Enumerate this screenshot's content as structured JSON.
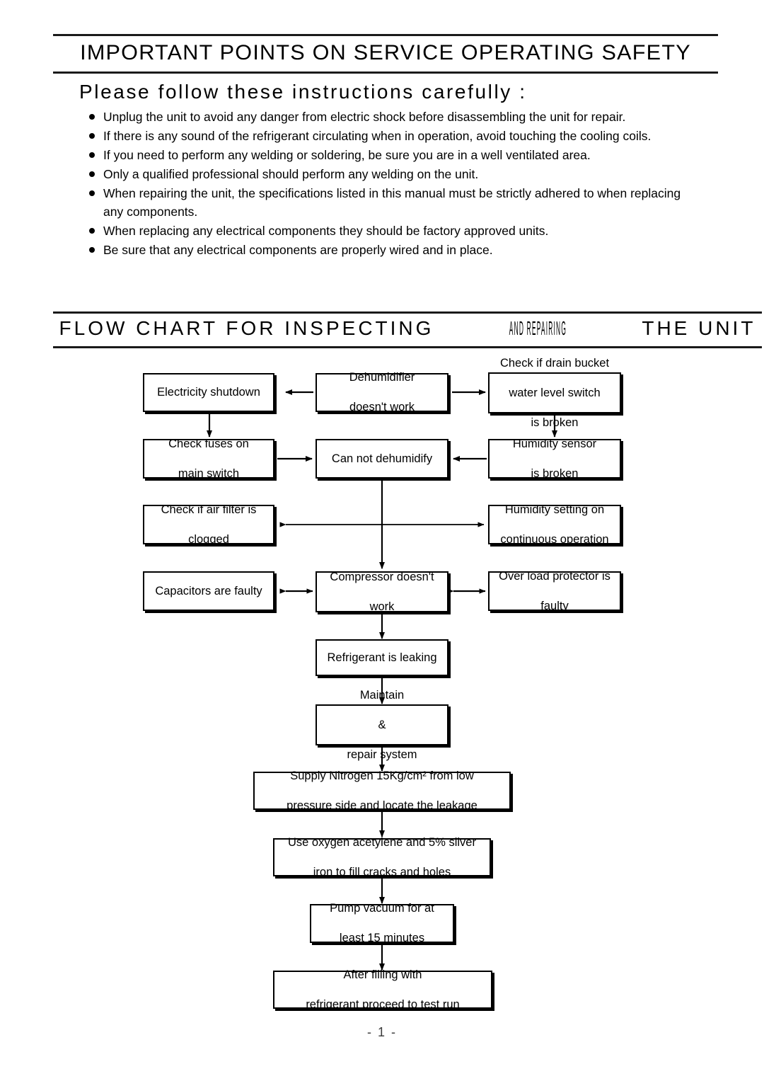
{
  "sections": {
    "safety": {
      "heading": "IMPORTANT POINTS ON SERVICE OPERATING SAFETY",
      "subheading": "Please follow these instructions carefully :",
      "bullets": [
        "Unplug the unit to avoid any danger from electric shock before disassembling the unit for repair.",
        "If there is any sound of the refrigerant circulating when in operation, avoid touching the cooling coils.",
        "If you need to perform any welding or soldering, be sure you are in a well ventilated area.",
        "Only a qualified professional should perform any welding on the unit.",
        "When repairing the unit, the specifications listed in this manual must be strictly adhered to when replacing any components.",
        "When replacing any electrical components they should be factory approved units.",
        "Be sure that any electrical components are properly wired and in place."
      ]
    },
    "flowchart": {
      "heading_part1": "FLOW CHART FOR INSPECTING ",
      "heading_part2": "AND REPAIRING",
      "heading_part3": " THE UNIT",
      "heading_full": "FLOW CHART FOR INSPECTING AND REPAIRING THE UNIT"
    }
  },
  "chart_data": {
    "type": "diagram",
    "title": "FLOW CHART FOR INSPECTING AND REPAIRING THE UNIT",
    "nodes": [
      {
        "id": "dehumidifier-doesnt-work",
        "label": "Dehumidifier\ndoesn't work"
      },
      {
        "id": "electricity-shutdown",
        "label": "Electricity shutdown"
      },
      {
        "id": "check-drain-bucket",
        "label": "Check if drain bucket\nwater level switch\nis broken"
      },
      {
        "id": "check-fuses",
        "label": "Check fuses on\nmain switch"
      },
      {
        "id": "can-not-dehumidify",
        "label": "Can not dehumidify"
      },
      {
        "id": "humidity-sensor-broken",
        "label": "Humidity sensor\nis broken"
      },
      {
        "id": "check-air-filter",
        "label": "Check if air filter is\nclogged"
      },
      {
        "id": "humidity-setting",
        "label": "Humidity setting on\ncontinuous operation"
      },
      {
        "id": "capacitors-faulty",
        "label": "Capacitors are faulty"
      },
      {
        "id": "compressor-doesnt-work",
        "label": "Compressor doesn't\nwork"
      },
      {
        "id": "over-load-protector",
        "label": "Over load protector is\nfaulty"
      },
      {
        "id": "refrigerant-leaking",
        "label": "Refrigerant is leaking"
      },
      {
        "id": "maintain-repair",
        "label": "Maintain\n&\nrepair system"
      },
      {
        "id": "supply-nitrogen",
        "label": "Supply Nitrogen 15Kg/cm² from low\npressure side and locate the leakage"
      },
      {
        "id": "oxygen-acetylene",
        "label": "Use oxygen acetylene and 5% silver\niron to fill cracks and holes"
      },
      {
        "id": "pump-vacuum",
        "label": "Pump vacuum for at\nleast 15 minutes"
      },
      {
        "id": "after-filling",
        "label": "After filling with\nrefrigerant proceed to test run"
      }
    ],
    "edges": [
      {
        "from": "dehumidifier-doesnt-work",
        "to": "electricity-shutdown",
        "dir": "single"
      },
      {
        "from": "dehumidifier-doesnt-work",
        "to": "check-drain-bucket",
        "dir": "single"
      },
      {
        "from": "electricity-shutdown",
        "to": "check-fuses",
        "dir": "single"
      },
      {
        "from": "check-drain-bucket",
        "to": "humidity-sensor-broken",
        "dir": "single"
      },
      {
        "from": "check-fuses",
        "to": "can-not-dehumidify",
        "dir": "single"
      },
      {
        "from": "humidity-sensor-broken",
        "to": "can-not-dehumidify",
        "dir": "single"
      },
      {
        "from": "check-air-filter",
        "to": "humidity-setting",
        "dir": "double"
      },
      {
        "from": "can-not-dehumidify",
        "to": "compressor-doesnt-work",
        "dir": "single"
      },
      {
        "from": "capacitors-faulty",
        "to": "compressor-doesnt-work",
        "dir": "double"
      },
      {
        "from": "compressor-doesnt-work",
        "to": "over-load-protector",
        "dir": "double"
      },
      {
        "from": "compressor-doesnt-work",
        "to": "refrigerant-leaking",
        "dir": "single"
      },
      {
        "from": "refrigerant-leaking",
        "to": "maintain-repair",
        "dir": "single"
      },
      {
        "from": "maintain-repair",
        "to": "supply-nitrogen",
        "dir": "single"
      },
      {
        "from": "supply-nitrogen",
        "to": "oxygen-acetylene",
        "dir": "single"
      },
      {
        "from": "oxygen-acetylene",
        "to": "pump-vacuum",
        "dir": "single"
      },
      {
        "from": "pump-vacuum",
        "to": "after-filling",
        "dir": "single"
      }
    ]
  },
  "nodes": {
    "electricity_shutdown": "Electricity shutdown",
    "dehumidifier_l1": "Dehumidifier",
    "dehumidifier_l2": "doesn't work",
    "drain_bucket_l1": "Check if drain bucket",
    "drain_bucket_l2": "water level switch",
    "drain_bucket_l3": "is broken",
    "check_fuses_l1": "Check fuses on",
    "check_fuses_l2": "main switch",
    "can_not_dehumidify": "Can not dehumidify",
    "humidity_sensor_l1": "Humidity sensor",
    "humidity_sensor_l2": "is broken",
    "air_filter_l1": "Check if air filter is",
    "air_filter_l2": "clogged",
    "humidity_setting_l1": "Humidity setting on",
    "humidity_setting_l2": "continuous operation",
    "capacitors": "Capacitors are faulty",
    "compressor_l1": "Compressor doesn't",
    "compressor_l2": "work",
    "over_load_l1": "Over load protector is",
    "over_load_l2": "faulty",
    "refrigerant_leaking": "Refrigerant is leaking",
    "maintain_l1": "Maintain",
    "maintain_l2": "&",
    "maintain_l3": "repair system",
    "nitrogen_l1": "Supply Nitrogen 15Kg/cm² from low",
    "nitrogen_l2": "pressure side and locate the leakage",
    "acetylene_l1": "Use oxygen acetylene and 5% silver",
    "acetylene_l2": "iron to fill cracks and holes",
    "pump_vacuum_l1": "Pump vacuum for at",
    "pump_vacuum_l2": "least 15 minutes",
    "after_filling_l1": "After filling with",
    "after_filling_l2": "refrigerant proceed to test run"
  },
  "footer": {
    "page_number": "- 1 -"
  }
}
